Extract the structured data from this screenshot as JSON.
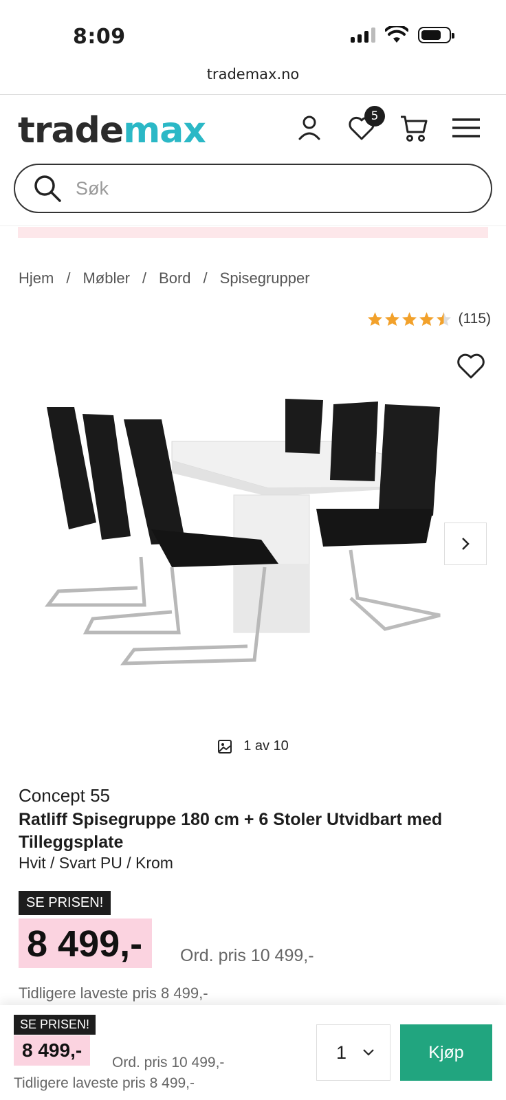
{
  "status_bar": {
    "time": "8:09"
  },
  "browser": {
    "url": "trademax.no"
  },
  "header": {
    "logo_part1": "trade",
    "logo_part2": "max",
    "wishlist_count": "5"
  },
  "search": {
    "placeholder": "Søk"
  },
  "breadcrumb": {
    "items": [
      "Hjem",
      "Møbler",
      "Bord",
      "Spisegrupper"
    ],
    "separator": "/"
  },
  "rating": {
    "stars": 4.5,
    "max_stars": 5,
    "count": "(115)"
  },
  "gallery": {
    "counter": "1 av 10"
  },
  "product": {
    "brand": "Concept 55",
    "title": "Ratliff Spisegruppe 180 cm + 6 Stoler Utvidbart med Tilleggsplate",
    "variant": "Hvit / Svart PU / Krom",
    "price_tag": "SE PRISEN!",
    "price": "8 499,-",
    "ord_price": "Ord. pris 10 499,-",
    "lowest_price": "Tidligere laveste pris 8 499,-"
  },
  "sticky": {
    "price_tag": "SE PRISEN!",
    "price": "8 499,-",
    "ord_price": "Ord. pris 10 499,-",
    "lowest_price": "Tidligere laveste pris 8 499,-",
    "quantity": "1",
    "buy_label": "Kjøp"
  },
  "colors": {
    "brand_teal": "#2bb8c6",
    "price_highlight": "#fbd3e0",
    "buy_green": "#21a57f",
    "star_orange": "#f2a12b"
  }
}
